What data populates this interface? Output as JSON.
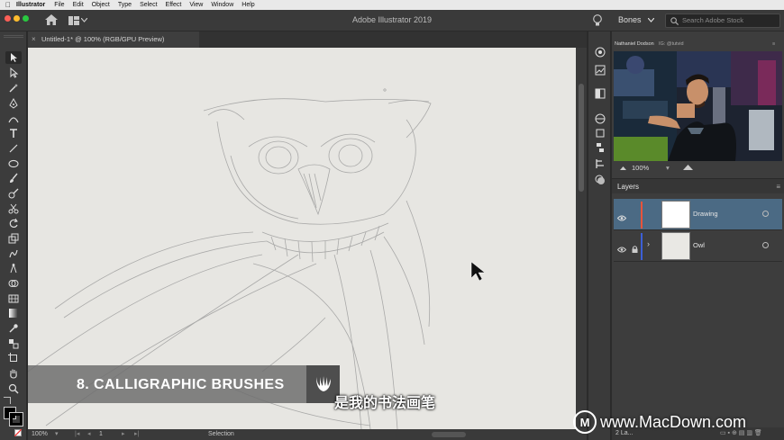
{
  "menubar": {
    "app_name": "Illustrator",
    "items": [
      "File",
      "Edit",
      "Object",
      "Type",
      "Select",
      "Effect",
      "View",
      "Window",
      "Help"
    ]
  },
  "appbar": {
    "title": "Adobe Illustrator 2019",
    "workspace": "Bones",
    "search_placeholder": "Search Adobe Stock"
  },
  "document": {
    "tab_title": "Untitled-1* @ 100% (RGB/GPU Preview)"
  },
  "lower_third": {
    "title": "8. CALLIGRAPHIC BRUSHES",
    "subtitle": "是我的书法画笔"
  },
  "statusbar": {
    "zoom": "100%",
    "artboard": "1",
    "tool": "Selection"
  },
  "navigator": {
    "tab_name": "Nathaniel Dodson",
    "tab_handle": "IG: @tutvid",
    "zoom": "100%"
  },
  "layers": {
    "panel_title": "Layers",
    "items": [
      {
        "name": "Drawing",
        "color": "#e8543b",
        "selected": true,
        "locked": false
      },
      {
        "name": "Owl",
        "color": "#3c5fd6",
        "selected": false,
        "locked": true
      }
    ],
    "footer": "2 La..."
  },
  "watermark": "www.MacDown.com",
  "colors": {
    "selection": "#4b6a84",
    "canvas": "#e7e6e2"
  }
}
